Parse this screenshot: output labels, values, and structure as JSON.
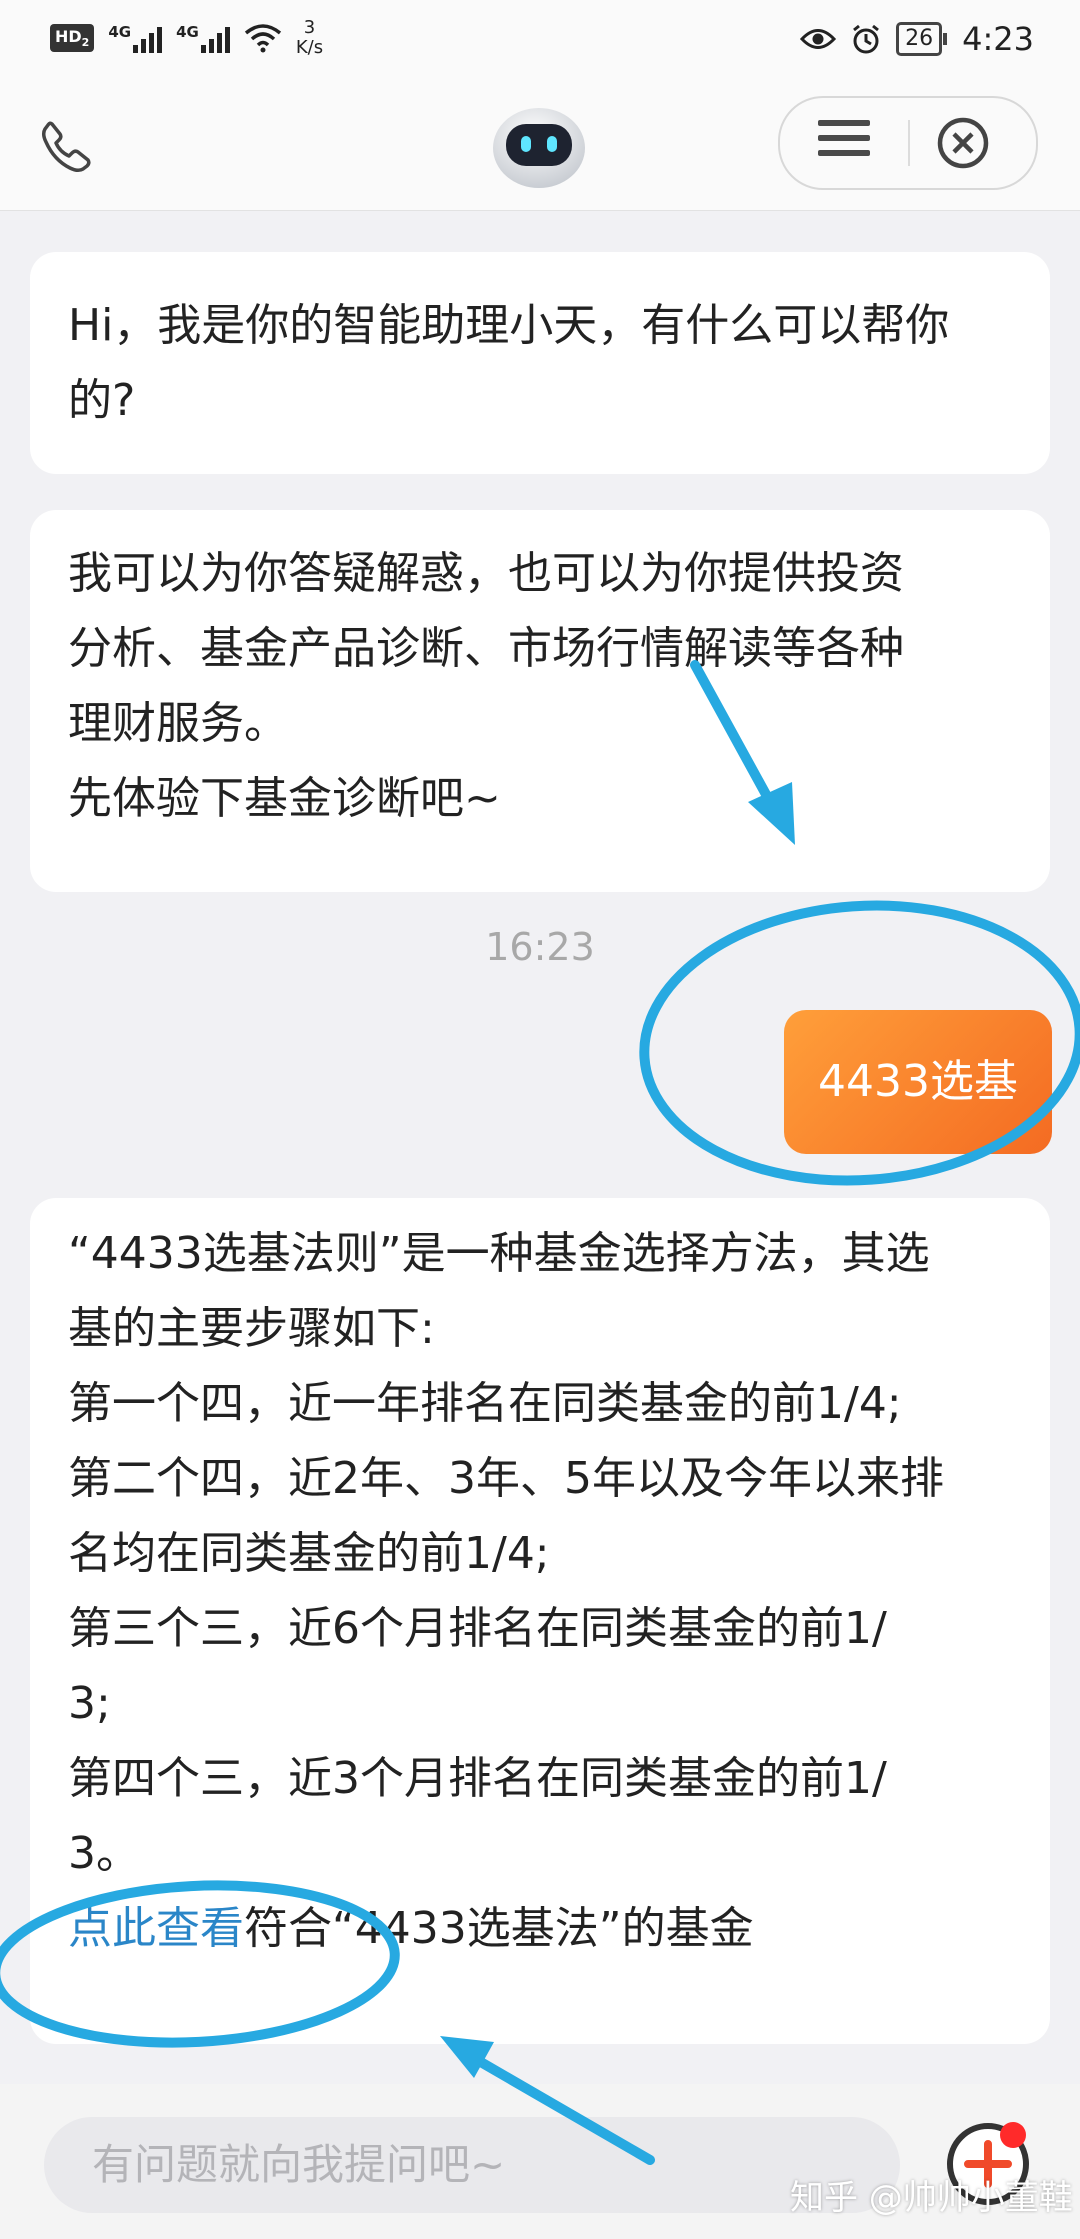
{
  "status_bar": {
    "hd_label": "HD",
    "hd_sub": "2",
    "signal1_label": "4G",
    "signal2_label": "4G",
    "speed_value": "3",
    "speed_unit": "K/s",
    "battery": "26",
    "time": "4:23",
    "icons": [
      "eye-icon",
      "alarm-icon"
    ]
  },
  "chat": {
    "bot_intro": "Hi，我是你的智能助理小天，有什么可以帮你的?",
    "bot_services": [
      "我可以为你答疑解惑，也可以为你提供投资",
      "分析、基金产品诊断、市场行情解读等各种",
      "理财服务。",
      "先体验下基金诊断吧~"
    ],
    "timestamp": "16:23",
    "user_message": "4433选基",
    "bot_answer_lines": [
      "“4433选基法则”是一种基金选择方法，其选",
      "基的主要步骤如下:",
      "第一个四，近一年排名在同类基金的前1/4;",
      "第二个四，近2年、3年、5年以及今年以来排",
      "名均在同类基金的前1/4;",
      "第三个三，近6个月排名在同类基金的前1/",
      "3;",
      "第四个三，近3个月排名在同类基金的前1/",
      "3。"
    ],
    "link_text": "点此查看",
    "link_suffix": "符合“4433选基法”的基金"
  },
  "input": {
    "placeholder": "有问题就向我提问吧~"
  },
  "watermark": "知乎 @帅帅小董鞋",
  "colors": {
    "user_bubble_start": "#ff9f3a",
    "user_bubble_end": "#f46b22",
    "link": "#2a86c8",
    "annotation": "#27a9e1"
  }
}
